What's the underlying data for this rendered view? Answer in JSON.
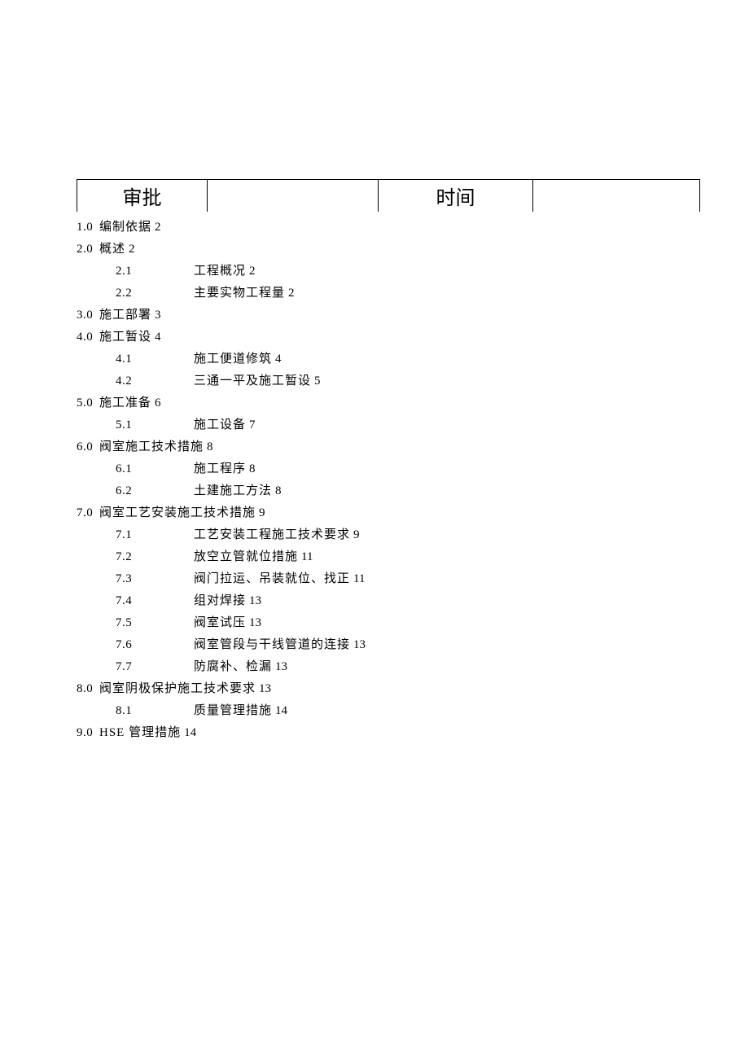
{
  "header": {
    "col1": "审批",
    "col2": "",
    "col3": "时间",
    "col4": ""
  },
  "toc": [
    {
      "level": 1,
      "num": "1.0",
      "title": "编制依据",
      "page": "2"
    },
    {
      "level": 1,
      "num": "2.0",
      "title": "概述",
      "page": "2"
    },
    {
      "level": 2,
      "num": "2.1",
      "title": "工程概况",
      "page": "2"
    },
    {
      "level": 2,
      "num": "2.2",
      "title": "主要实物工程量",
      "page": "2"
    },
    {
      "level": 1,
      "num": "3.0",
      "title": "施工部署",
      "page": "3"
    },
    {
      "level": 1,
      "num": "4.0",
      "title": "施工暂设",
      "page": "4"
    },
    {
      "level": 2,
      "num": "4.1",
      "title": "施工便道修筑",
      "page": "4"
    },
    {
      "level": 2,
      "num": "4.2",
      "title": "三通一平及施工暂设",
      "page": "5"
    },
    {
      "level": 1,
      "num": "5.0",
      "title": "施工准备",
      "page": "6"
    },
    {
      "level": 2,
      "num": "5.1",
      "title": "施工设备",
      "page": "7"
    },
    {
      "level": 1,
      "num": "6.0",
      "title": "阀室施工技术措施",
      "page": "8"
    },
    {
      "level": 2,
      "num": "6.1",
      "title": "施工程序",
      "page": "8"
    },
    {
      "level": 2,
      "num": "6.2",
      "title": "土建施工方法",
      "page": "8"
    },
    {
      "level": 1,
      "num": "7.0",
      "title": "阀室工艺安装施工技术措施",
      "page": "9"
    },
    {
      "level": 2,
      "num": "7.1",
      "title": "工艺安装工程施工技术要求",
      "page": "9"
    },
    {
      "level": 2,
      "num": "7.2",
      "title": "放空立管就位措施",
      "page": "11"
    },
    {
      "level": 2,
      "num": "7.3",
      "title": "阀门拉运、吊装就位、找正",
      "page": "11"
    },
    {
      "level": 2,
      "num": "7.4",
      "title": "组对焊接",
      "page": "13"
    },
    {
      "level": 2,
      "num": "7.5",
      "title": "阀室试压",
      "page": "13"
    },
    {
      "level": 2,
      "num": "7.6",
      "title": "阀室管段与干线管道的连接",
      "page": "13"
    },
    {
      "level": 2,
      "num": "7.7",
      "title": "防腐补、检漏",
      "page": "13"
    },
    {
      "level": 1,
      "num": "8.0",
      "title": "阀室阴极保护施工技术要求",
      "page": "13"
    },
    {
      "level": 2,
      "num": "8.1",
      "title": "质量管理措施",
      "page": "14"
    },
    {
      "level": 1,
      "num": "9.0",
      "title": "HSE 管理措施",
      "page": "14"
    }
  ]
}
